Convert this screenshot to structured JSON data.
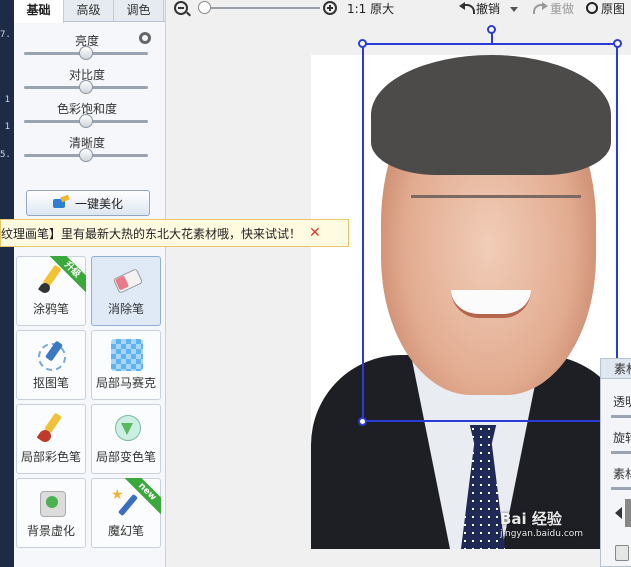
{
  "left_strip": {
    "marks": [
      "7.",
      "1",
      "1",
      "5."
    ]
  },
  "tabs": [
    {
      "label": "基础",
      "active": true
    },
    {
      "label": "高级",
      "active": false
    },
    {
      "label": "调色",
      "active": false
    }
  ],
  "adjustments": [
    {
      "label": "亮度",
      "value": 0.5
    },
    {
      "label": "对比度",
      "value": 0.5
    },
    {
      "label": "色彩饱和度",
      "value": 0.5
    },
    {
      "label": "清晰度",
      "value": 0.5
    }
  ],
  "reset_icon": "reset-icon",
  "beautify_button": {
    "label": "一键美化",
    "icon": "magic-wand-icon"
  },
  "notification": {
    "text": "纹理画笔】里有最新大热的东北大花素材哦，快来试试！",
    "close": "✕"
  },
  "tools": [
    {
      "label": "涂鸦笔",
      "icon": "brush-icon",
      "badge": "升级",
      "selected": false
    },
    {
      "label": "消除笔",
      "icon": "eraser-icon",
      "badge": "",
      "selected": true
    },
    {
      "label": "抠图笔",
      "icon": "cutout-pen-icon",
      "badge": "",
      "selected": false
    },
    {
      "label": "局部马赛克",
      "icon": "mosaic-icon",
      "badge": "",
      "selected": false
    },
    {
      "label": "局部彩色笔",
      "icon": "color-pen-icon",
      "badge": "",
      "selected": false
    },
    {
      "label": "局部变色笔",
      "icon": "color-change-icon",
      "badge": "",
      "selected": false
    },
    {
      "label": "背景虚化",
      "icon": "blur-icon",
      "badge": "",
      "selected": false
    },
    {
      "label": "魔幻笔",
      "icon": "magic-pen-icon",
      "badge": "new",
      "selected": false
    }
  ],
  "toolbar": {
    "zoom_level": 0.05,
    "original_size_label": "1:1 原大",
    "undo_label": "撤销",
    "redo_label": "重做",
    "original_label": "原图"
  },
  "float_panel": {
    "title": "素材",
    "rows": [
      "透明",
      "旋转",
      "素材"
    ]
  },
  "watermark": {
    "text": "Bai 经验",
    "sub": "jingyan.baidu.com"
  }
}
